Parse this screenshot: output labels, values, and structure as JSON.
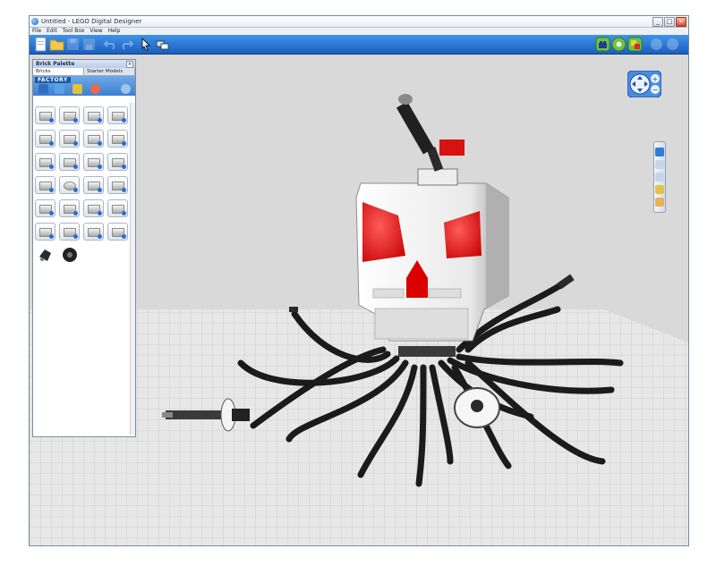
{
  "window": {
    "title": "Untitled - LEGO Digital Designer",
    "controls": [
      "_",
      "□",
      "×"
    ]
  },
  "menu": [
    "File",
    "Edit",
    "Tool Box",
    "View",
    "Help"
  ],
  "toolbar": {
    "left_icons": [
      "new-file-icon",
      "open-folder-icon",
      "save-icon",
      "save-as-icon",
      "undo-icon",
      "redo-icon",
      "select-tool-icon",
      "clone-tool-icon"
    ],
    "right_icons": [
      "build-mode-icon",
      "view-mode-icon",
      "instructions-mode-icon",
      "share-icon",
      "help-icon"
    ],
    "accent": "#1f6ccf"
  },
  "palette": {
    "title": "Brick Palette",
    "tabs": [
      "Bricks",
      "Starter Models"
    ],
    "active_tab": "Bricks",
    "brand": "FACTORY",
    "category_icons": [
      "paint-bucket-icon",
      "gear-icon",
      "clipboard-icon",
      "palette-icon",
      "search-icon"
    ],
    "tile_count": 26
  },
  "navigation": {
    "icons": [
      "orbit-arrows-icon",
      "zoom-in-icon",
      "zoom-out-icon"
    ],
    "zoom_in": "+",
    "zoom_out": "−"
  },
  "side_tools": [
    "select-icon",
    "hinge-icon",
    "flex-icon",
    "paint-icon",
    "hide-icon"
  ],
  "scene": {
    "model": "robot skull with tentacles",
    "colors": {
      "white": "#f2f2f2",
      "red": "#e01010",
      "black": "#1a1a1a",
      "grid": "#c9c9c9"
    }
  }
}
